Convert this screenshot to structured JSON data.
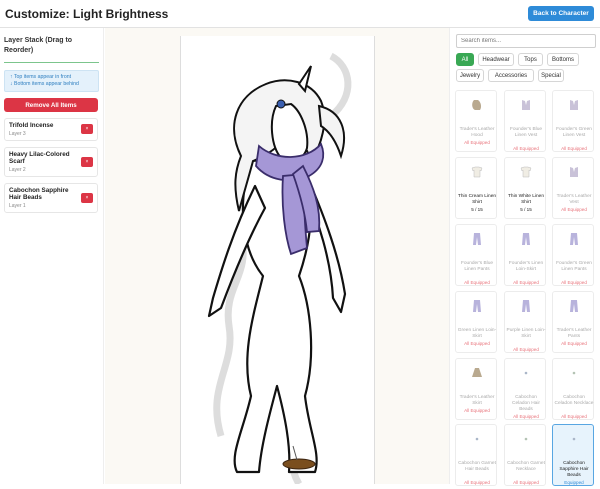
{
  "header": {
    "title": "Customize: Light Brightness",
    "back_label": "Back to Character"
  },
  "layer_panel": {
    "title": "Layer Stack (Drag to Reorder)",
    "hint_top": "↑ Top items appear in front",
    "hint_bottom": "↓ Bottom items appear behind",
    "remove_all_label": "Remove All Items",
    "remove_glyph": "×",
    "layers": [
      {
        "name": "Trifold Incense",
        "layer": "Layer 3"
      },
      {
        "name": "Heavy Lilac-Colored Scarf",
        "layer": "Layer 2"
      },
      {
        "name": "Cabochon Sapphire Hair Beads",
        "layer": "Layer 1"
      }
    ]
  },
  "search": {
    "placeholder": "Search items..."
  },
  "tabs": [
    {
      "label": "All",
      "active": true
    },
    {
      "label": "Headwear",
      "active": false
    },
    {
      "label": "Tops",
      "active": false
    },
    {
      "label": "Bottoms",
      "active": false
    },
    {
      "label": "Jewelry",
      "active": false
    },
    {
      "label": "Accessories",
      "active": false
    },
    {
      "label": "Special",
      "active": false
    }
  ],
  "items": [
    {
      "name": "Trader's Leather Hood",
      "status": "All Equipped",
      "icon": "hood-icon",
      "state": "faded"
    },
    {
      "name": "Founder's Blue Linen Vest",
      "status": "All Equipped",
      "icon": "vest-icon",
      "state": "faded"
    },
    {
      "name": "Founder's Green Linen Vest",
      "status": "All Equipped",
      "icon": "vest-icon",
      "state": "faded"
    },
    {
      "name": "Thin Cream Linen Shirt",
      "status": "5 / 15",
      "icon": "shirt-icon",
      "state": "available"
    },
    {
      "name": "Thin White Linen Shirt",
      "status": "5 / 15",
      "icon": "shirt-icon",
      "state": "available"
    },
    {
      "name": "Trader's Leather Vest",
      "status": "All Equipped",
      "icon": "vest-icon",
      "state": "faded"
    },
    {
      "name": "Founder's Blue Linen Pants",
      "status": "All Equipped",
      "icon": "pants-icon",
      "state": "faded"
    },
    {
      "name": "Founder's Linen Loin-Skirt",
      "status": "All Equipped",
      "icon": "pants-icon",
      "state": "faded"
    },
    {
      "name": "Founder's Green Linen Pants",
      "status": "All Equipped",
      "icon": "pants-icon",
      "state": "faded"
    },
    {
      "name": "Green Linen Loin-Skirt",
      "status": "All Equipped",
      "icon": "pants-icon",
      "state": "faded"
    },
    {
      "name": "Purple Linen Loin-Skirt",
      "status": "All Equipped",
      "icon": "pants-icon",
      "state": "faded"
    },
    {
      "name": "Trader's Leather Pants",
      "status": "All Equipped",
      "icon": "pants-icon",
      "state": "faded"
    },
    {
      "name": "Trader's Leather Skirt",
      "status": "All Equipped",
      "icon": "skirt-icon",
      "state": "faded"
    },
    {
      "name": "Cabochon Celadon Hair Beads",
      "status": "All Equipped",
      "icon": "beads-icon",
      "state": "faded"
    },
    {
      "name": "Cabochon Celadon Necklace",
      "status": "All Equipped",
      "icon": "necklace-icon",
      "state": "faded"
    },
    {
      "name": "Cabochon Garnet Hair Beads",
      "status": "All Equipped",
      "icon": "beads-icon",
      "state": "faded"
    },
    {
      "name": "Cabochon Garnet Necklace",
      "status": "All Equipped",
      "icon": "necklace-icon",
      "state": "faded"
    },
    {
      "name": "Cabochon Sapphire Hair Beads",
      "status": "Equipped",
      "icon": "beads-icon",
      "state": "selected"
    }
  ],
  "colors": {
    "accent_blue": "#2e8bd8",
    "danger_red": "#dc3545",
    "active_green": "#39a854",
    "scarf_purple": "#9f8fd0"
  }
}
